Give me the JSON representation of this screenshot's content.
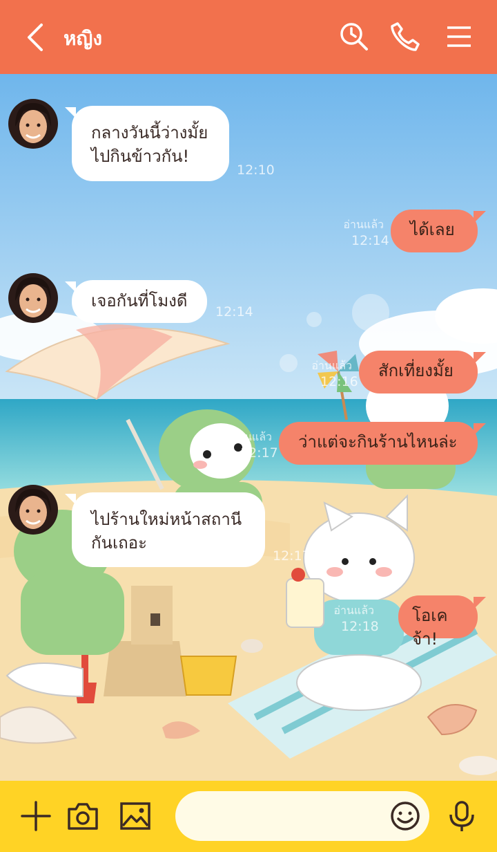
{
  "header": {
    "title": "หญิง",
    "icons": [
      "back-chevron-icon",
      "search-icon",
      "phone-icon",
      "menu-icon"
    ]
  },
  "messages": [
    {
      "side": "incoming",
      "text": "กลางวันนี้ว่างมั้ย\nไปกินข้าวกัน!",
      "time": "12:10"
    },
    {
      "side": "outgoing",
      "text": "ได้เลย",
      "read": "อ่านแล้ว",
      "time": "12:14"
    },
    {
      "side": "incoming",
      "text": "เจอกันที่โมงดี",
      "time": "12:14"
    },
    {
      "side": "outgoing",
      "text": "สักเที่ยงมั้ย",
      "read": "อ่านแล้ว",
      "time": "12:16"
    },
    {
      "side": "outgoing",
      "text": "ว่าแต่จะกินร้านไหนล่ะ",
      "read": "อ่านแล้ว",
      "time": "12:17"
    },
    {
      "side": "incoming",
      "text": "ไปร้านใหม่หน้าสถานี\nกันเถอะ",
      "time": "12:17"
    },
    {
      "side": "outgoing",
      "text": "โอเคจ้า!",
      "read": "อ่านแล้ว",
      "time": "12:18"
    }
  ],
  "input_bar": {
    "placeholder": "",
    "icons": [
      "plus-icon",
      "camera-icon",
      "image-icon",
      "emoji-icon",
      "microphone-icon"
    ]
  },
  "colors": {
    "header": "#F2714D",
    "outgoing_bubble": "#F5836A",
    "incoming_bubble": "#FFFFFF",
    "input_bar": "#FFD325"
  }
}
